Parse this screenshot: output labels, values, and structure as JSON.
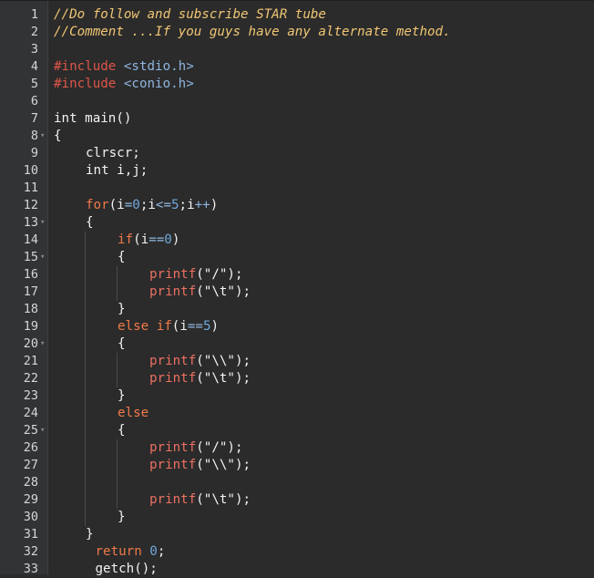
{
  "editor": {
    "lines": [
      {
        "n": "1",
        "fold": "",
        "indent": 0,
        "tokens": [
          {
            "t": "cm",
            "v": "//Do follow and subscribe STAR tube"
          }
        ]
      },
      {
        "n": "2",
        "fold": "",
        "indent": 0,
        "tokens": [
          {
            "t": "cm",
            "v": "//Comment ...If you guys have any alternate method."
          }
        ]
      },
      {
        "n": "3",
        "fold": "",
        "indent": 0,
        "tokens": []
      },
      {
        "n": "4",
        "fold": "",
        "indent": 0,
        "tokens": [
          {
            "t": "pp",
            "v": "#include "
          },
          {
            "t": "inc",
            "v": "<stdio.h>"
          }
        ]
      },
      {
        "n": "5",
        "fold": "",
        "indent": 0,
        "tokens": [
          {
            "t": "pp",
            "v": "#include "
          },
          {
            "t": "inc",
            "v": "<conio.h>"
          }
        ]
      },
      {
        "n": "6",
        "fold": "",
        "indent": 0,
        "tokens": []
      },
      {
        "n": "7",
        "fold": "",
        "indent": 0,
        "tokens": [
          {
            "t": "pl",
            "v": "int main()"
          }
        ]
      },
      {
        "n": "8",
        "fold": "▾",
        "indent": 0,
        "tokens": [
          {
            "t": "pl",
            "v": "{"
          }
        ]
      },
      {
        "n": "9",
        "fold": "",
        "indent": 1,
        "tokens": [
          {
            "t": "pl",
            "v": "clrscr;"
          }
        ]
      },
      {
        "n": "10",
        "fold": "",
        "indent": 1,
        "tokens": [
          {
            "t": "pl",
            "v": "int i,j;"
          }
        ]
      },
      {
        "n": "11",
        "fold": "",
        "indent": 0,
        "tokens": []
      },
      {
        "n": "12",
        "fold": "",
        "indent": 1,
        "tokens": [
          {
            "t": "kw",
            "v": "for"
          },
          {
            "t": "pl",
            "v": "(i"
          },
          {
            "t": "op",
            "v": "="
          },
          {
            "t": "num",
            "v": "0"
          },
          {
            "t": "pl",
            "v": ";i"
          },
          {
            "t": "op",
            "v": "<="
          },
          {
            "t": "num",
            "v": "5"
          },
          {
            "t": "pl",
            "v": ";i"
          },
          {
            "t": "op",
            "v": "++"
          },
          {
            "t": "pl",
            "v": ")"
          }
        ]
      },
      {
        "n": "13",
        "fold": "▾",
        "indent": 1,
        "tokens": [
          {
            "t": "pl",
            "v": "{"
          }
        ]
      },
      {
        "n": "14",
        "fold": "",
        "indent": 2,
        "tokens": [
          {
            "t": "kw",
            "v": "if"
          },
          {
            "t": "pl",
            "v": "(i"
          },
          {
            "t": "op",
            "v": "=="
          },
          {
            "t": "num",
            "v": "0"
          },
          {
            "t": "pl",
            "v": ")"
          }
        ]
      },
      {
        "n": "15",
        "fold": "▾",
        "indent": 2,
        "tokens": [
          {
            "t": "pl",
            "v": "{"
          }
        ]
      },
      {
        "n": "16",
        "fold": "",
        "indent": 3,
        "tokens": [
          {
            "t": "fn",
            "v": "printf"
          },
          {
            "t": "pl",
            "v": "("
          },
          {
            "t": "str",
            "v": "\"/\""
          },
          {
            "t": "pl",
            "v": ");"
          }
        ]
      },
      {
        "n": "17",
        "fold": "",
        "indent": 3,
        "tokens": [
          {
            "t": "fn",
            "v": "printf"
          },
          {
            "t": "pl",
            "v": "("
          },
          {
            "t": "str",
            "v": "\"\\t\""
          },
          {
            "t": "pl",
            "v": ");"
          }
        ]
      },
      {
        "n": "18",
        "fold": "",
        "indent": 2,
        "tokens": [
          {
            "t": "pl",
            "v": "}"
          }
        ]
      },
      {
        "n": "19",
        "fold": "",
        "indent": 2,
        "tokens": [
          {
            "t": "kw",
            "v": "else if"
          },
          {
            "t": "pl",
            "v": "(i"
          },
          {
            "t": "op",
            "v": "=="
          },
          {
            "t": "num",
            "v": "5"
          },
          {
            "t": "pl",
            "v": ")"
          }
        ]
      },
      {
        "n": "20",
        "fold": "▾",
        "indent": 2,
        "tokens": [
          {
            "t": "pl",
            "v": "{"
          }
        ]
      },
      {
        "n": "21",
        "fold": "",
        "indent": 3,
        "tokens": [
          {
            "t": "fn",
            "v": "printf"
          },
          {
            "t": "pl",
            "v": "("
          },
          {
            "t": "str",
            "v": "\"\\\\\""
          },
          {
            "t": "pl",
            "v": ");"
          }
        ]
      },
      {
        "n": "22",
        "fold": "",
        "indent": 3,
        "tokens": [
          {
            "t": "fn",
            "v": "printf"
          },
          {
            "t": "pl",
            "v": "("
          },
          {
            "t": "str",
            "v": "\"\\t\""
          },
          {
            "t": "pl",
            "v": ");"
          }
        ]
      },
      {
        "n": "23",
        "fold": "",
        "indent": 2,
        "tokens": [
          {
            "t": "pl",
            "v": "}"
          }
        ]
      },
      {
        "n": "24",
        "fold": "",
        "indent": 2,
        "tokens": [
          {
            "t": "kw",
            "v": "else"
          }
        ]
      },
      {
        "n": "25",
        "fold": "▾",
        "indent": 2,
        "tokens": [
          {
            "t": "pl",
            "v": "{"
          }
        ]
      },
      {
        "n": "26",
        "fold": "",
        "indent": 3,
        "tokens": [
          {
            "t": "fn",
            "v": "printf"
          },
          {
            "t": "pl",
            "v": "("
          },
          {
            "t": "str",
            "v": "\"/\""
          },
          {
            "t": "pl",
            "v": ");"
          }
        ]
      },
      {
        "n": "27",
        "fold": "",
        "indent": 3,
        "tokens": [
          {
            "t": "fn",
            "v": "printf"
          },
          {
            "t": "pl",
            "v": "("
          },
          {
            "t": "str",
            "v": "\"\\\\\""
          },
          {
            "t": "pl",
            "v": ");"
          }
        ]
      },
      {
        "n": "28",
        "fold": "",
        "indent": 0,
        "tokens": []
      },
      {
        "n": "29",
        "fold": "",
        "indent": 3,
        "tokens": [
          {
            "t": "fn",
            "v": "printf"
          },
          {
            "t": "pl",
            "v": "("
          },
          {
            "t": "str",
            "v": "\"\\t\""
          },
          {
            "t": "pl",
            "v": ");"
          }
        ]
      },
      {
        "n": "30",
        "fold": "",
        "indent": 2,
        "tokens": [
          {
            "t": "pl",
            "v": "}"
          }
        ]
      },
      {
        "n": "31",
        "fold": "",
        "indent": 1,
        "tokens": [
          {
            "t": "pl",
            "v": "}"
          }
        ]
      },
      {
        "n": "32",
        "fold": "",
        "indent": 1.3,
        "tokens": [
          {
            "t": "kw",
            "v": "return "
          },
          {
            "t": "num",
            "v": "0"
          },
          {
            "t": "pl",
            "v": ";"
          }
        ]
      },
      {
        "n": "33",
        "fold": "",
        "indent": 1.3,
        "tokens": [
          {
            "t": "pl",
            "v": "getch();"
          }
        ]
      }
    ]
  },
  "colors": {
    "background": "#2b2b2b",
    "gutter": "#313335",
    "comment": "#f0c674",
    "keyword": "#f07a4a",
    "number": "#6fa8dc",
    "function": "#ec7063"
  }
}
